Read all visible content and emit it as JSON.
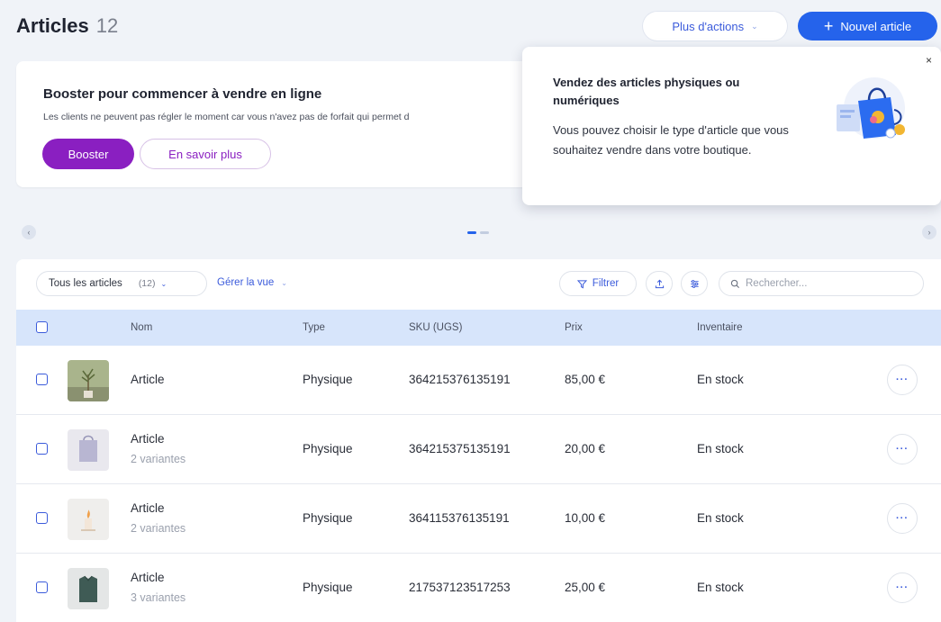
{
  "header": {
    "title": "Articles",
    "count": "12",
    "more_actions": "Plus d'actions",
    "new_article": "Nouvel article"
  },
  "booster": {
    "title": "Booster pour commencer à vendre en ligne",
    "description": "Les clients ne peuvent pas régler le moment car vous n'avez pas de forfait qui permet d",
    "booster_button": "Booster",
    "learn_more_button": "En savoir plus"
  },
  "popover": {
    "title": "Vendez des articles physiques ou numériques",
    "body": "Vous pouvez choisir le type d'article que vous souhaitez vendre dans votre boutique.",
    "close": "×"
  },
  "carousel": {
    "pages": 2,
    "active_index": 0
  },
  "toolbar": {
    "view_label": "Tous les articles",
    "view_count": "(12)",
    "manage_view": "Gérer la vue",
    "filter": "Filtrer",
    "search_placeholder": "Rechercher..."
  },
  "table": {
    "columns": {
      "name": "Nom",
      "type": "Type",
      "sku": "SKU (UGS)",
      "price": "Prix",
      "inventory": "Inventaire"
    },
    "rows": [
      {
        "name": "Article",
        "variants": "",
        "type": "Physique",
        "sku": "364215376135191",
        "price": "85,00 €",
        "inventory": "En stock",
        "thumb": "plant"
      },
      {
        "name": "Article",
        "variants": "2 variantes",
        "type": "Physique",
        "sku": "364215375135191",
        "price": "20,00 €",
        "inventory": "En stock",
        "thumb": "bag"
      },
      {
        "name": "Article",
        "variants": "2 variantes",
        "type": "Physique",
        "sku": "364115376135191",
        "price": "10,00 €",
        "inventory": "En stock",
        "thumb": "candle"
      },
      {
        "name": "Article",
        "variants": "3 variantes",
        "type": "Physique",
        "sku": "217537123517253",
        "price": "25,00 €",
        "inventory": "En stock",
        "thumb": "shirt"
      }
    ],
    "row_more": "···"
  },
  "colors": {
    "accent": "#2563eb",
    "booster": "#8a1fc1",
    "header_row": "#d7e5fb",
    "page_bg": "#f0f3f8"
  }
}
